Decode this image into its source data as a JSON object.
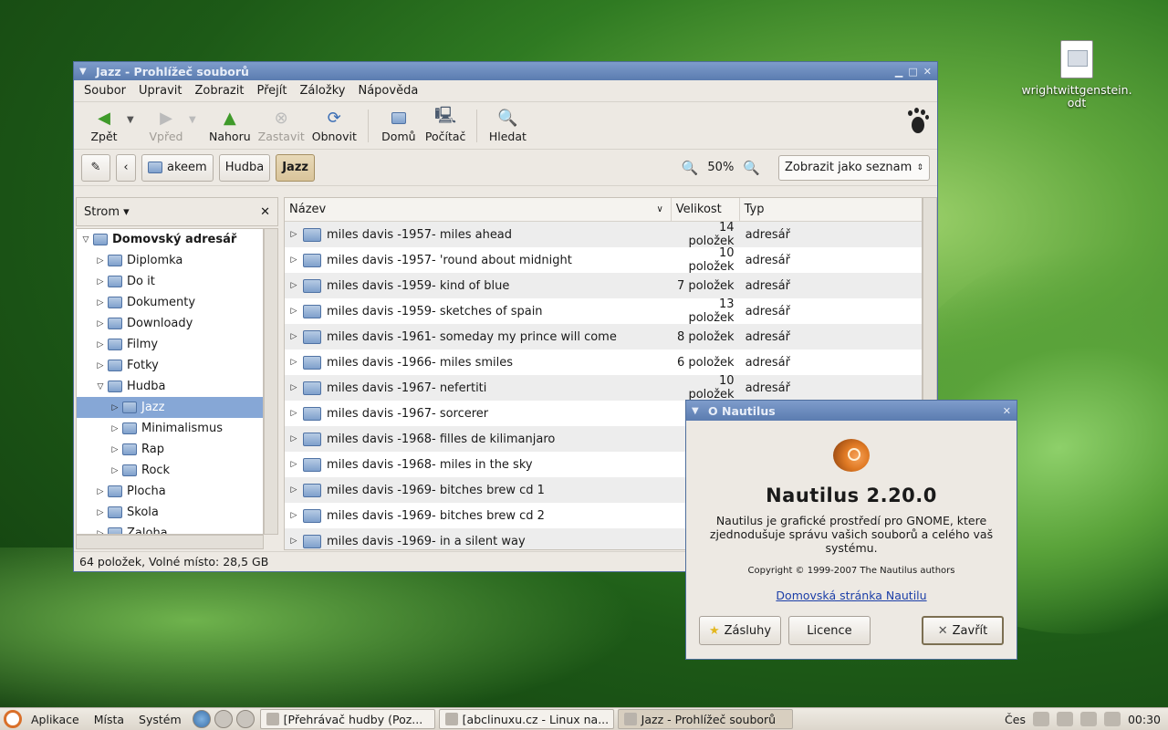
{
  "desktop": {
    "file_label": "wrightwittgenstein.\nodt"
  },
  "window": {
    "title": "Jazz - Prohlížeč souborů",
    "menu": [
      "Soubor",
      "Upravit",
      "Zobrazit",
      "Přejít",
      "Záložky",
      "Nápověda"
    ],
    "toolbar": {
      "back": "Zpět",
      "forward": "Vpřed",
      "up": "Nahoru",
      "stop": "Zastavit",
      "reload": "Obnovit",
      "home": "Domů",
      "computer": "Počítač",
      "search": "Hledat"
    },
    "location": {
      "crumbs": [
        "akeem",
        "Hudba",
        "Jazz"
      ],
      "zoom": "50%",
      "view_mode": "Zobrazit jako seznam"
    },
    "sidebar": {
      "mode": "Strom",
      "tree": [
        {
          "label": "Domovský adresář",
          "level": 0,
          "expanded": true
        },
        {
          "label": "Diplomka",
          "level": 1
        },
        {
          "label": "Do it",
          "level": 1
        },
        {
          "label": "Dokumenty",
          "level": 1
        },
        {
          "label": "Downloady",
          "level": 1
        },
        {
          "label": "Filmy",
          "level": 1
        },
        {
          "label": "Fotky",
          "level": 1
        },
        {
          "label": "Hudba",
          "level": 1,
          "expanded": true
        },
        {
          "label": "Jazz",
          "level": 2,
          "selected": true
        },
        {
          "label": "Minimalismus",
          "level": 2
        },
        {
          "label": "Rap",
          "level": 2
        },
        {
          "label": "Rock",
          "level": 2
        },
        {
          "label": "Plocha",
          "level": 1
        },
        {
          "label": "Skola",
          "level": 1
        },
        {
          "label": "Zaloha",
          "level": 1
        }
      ]
    },
    "list": {
      "columns": [
        "Název",
        "Velikost",
        "Typ"
      ],
      "rows": [
        {
          "name": "miles davis -1957- miles ahead",
          "size": "14 položek",
          "type": "adresář"
        },
        {
          "name": "miles davis -1957- 'round about midnight",
          "size": "10 položek",
          "type": "adresář"
        },
        {
          "name": "miles davis -1959- kind of blue",
          "size": "7 položek",
          "type": "adresář"
        },
        {
          "name": "miles davis -1959- sketches of spain",
          "size": "13 položek",
          "type": "adresář"
        },
        {
          "name": "miles davis -1961- someday my prince will come",
          "size": "8 položek",
          "type": "adresář"
        },
        {
          "name": "miles davis -1966- miles smiles",
          "size": "6 položek",
          "type": "adresář"
        },
        {
          "name": "miles davis -1967- nefertiti",
          "size": "10 položek",
          "type": "adresář"
        },
        {
          "name": "miles davis -1967- sorcerer",
          "size": "",
          "type": ""
        },
        {
          "name": "miles davis -1968- filles de kilimanjaro",
          "size": "",
          "type": ""
        },
        {
          "name": "miles davis -1968- miles in the sky",
          "size": "",
          "type": ""
        },
        {
          "name": "miles davis -1969- bitches brew cd 1",
          "size": "",
          "type": ""
        },
        {
          "name": "miles davis -1969- bitches brew cd 2",
          "size": "",
          "type": ""
        },
        {
          "name": "miles davis -1969- in a silent way",
          "size": "",
          "type": ""
        }
      ]
    },
    "status": "64 položek, Volné místo: 28,5 GB"
  },
  "about": {
    "title": "O Nautilus",
    "app_name": "Nautilus 2.20.0",
    "description": "Nautilus je grafické prostředí pro GNOME, ktere zjednodušuje správu vašich souborů a celého vaš systému.",
    "copyright": "Copyright © 1999-2007 The Nautilus authors",
    "link": "Domovská stránka Nautilu",
    "buttons": {
      "credits": "Zásluhy",
      "license": "Licence",
      "close": "Zavřít"
    }
  },
  "taskbar": {
    "menus": [
      "Aplikace",
      "Místa",
      "Systém"
    ],
    "tasks": [
      {
        "label": "[Přehrávač hudby (Poz...",
        "active": false
      },
      {
        "label": "[abclinuxu.cz - Linux na...",
        "active": false
      },
      {
        "label": "Jazz - Prohlížeč souborů",
        "active": true
      }
    ],
    "keyboard": "Čes",
    "clock": "00:30"
  }
}
